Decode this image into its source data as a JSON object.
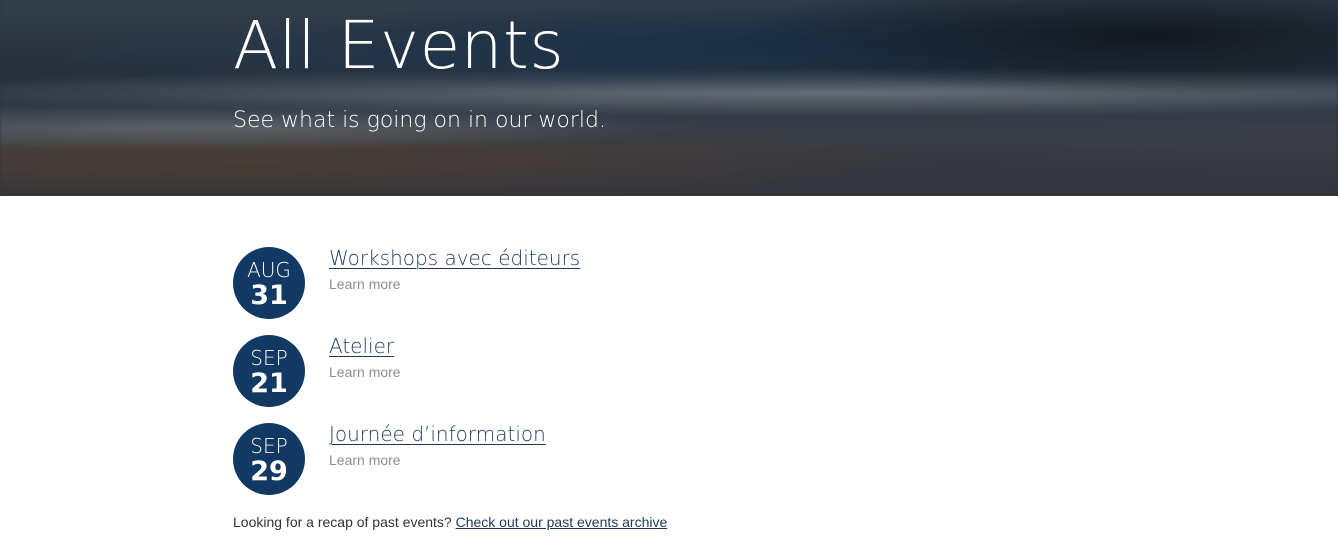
{
  "hero": {
    "title": "All Events",
    "subtitle": "See what is going on in our world."
  },
  "events": [
    {
      "month": "AUG",
      "day": "31",
      "title": "Workshops avec éditeurs",
      "more": "Learn more"
    },
    {
      "month": "SEP",
      "day": "21",
      "title": "Atelier",
      "more": "Learn more"
    },
    {
      "month": "SEP",
      "day": "29",
      "title": "Journée d’information",
      "more": "Learn more"
    }
  ],
  "archive": {
    "prompt": "Looking for a recap of past events?",
    "link": "Check out our past events archive"
  },
  "colors": {
    "badge": "#123963",
    "link": "#1f3a5a",
    "muted": "#8a8f94"
  }
}
